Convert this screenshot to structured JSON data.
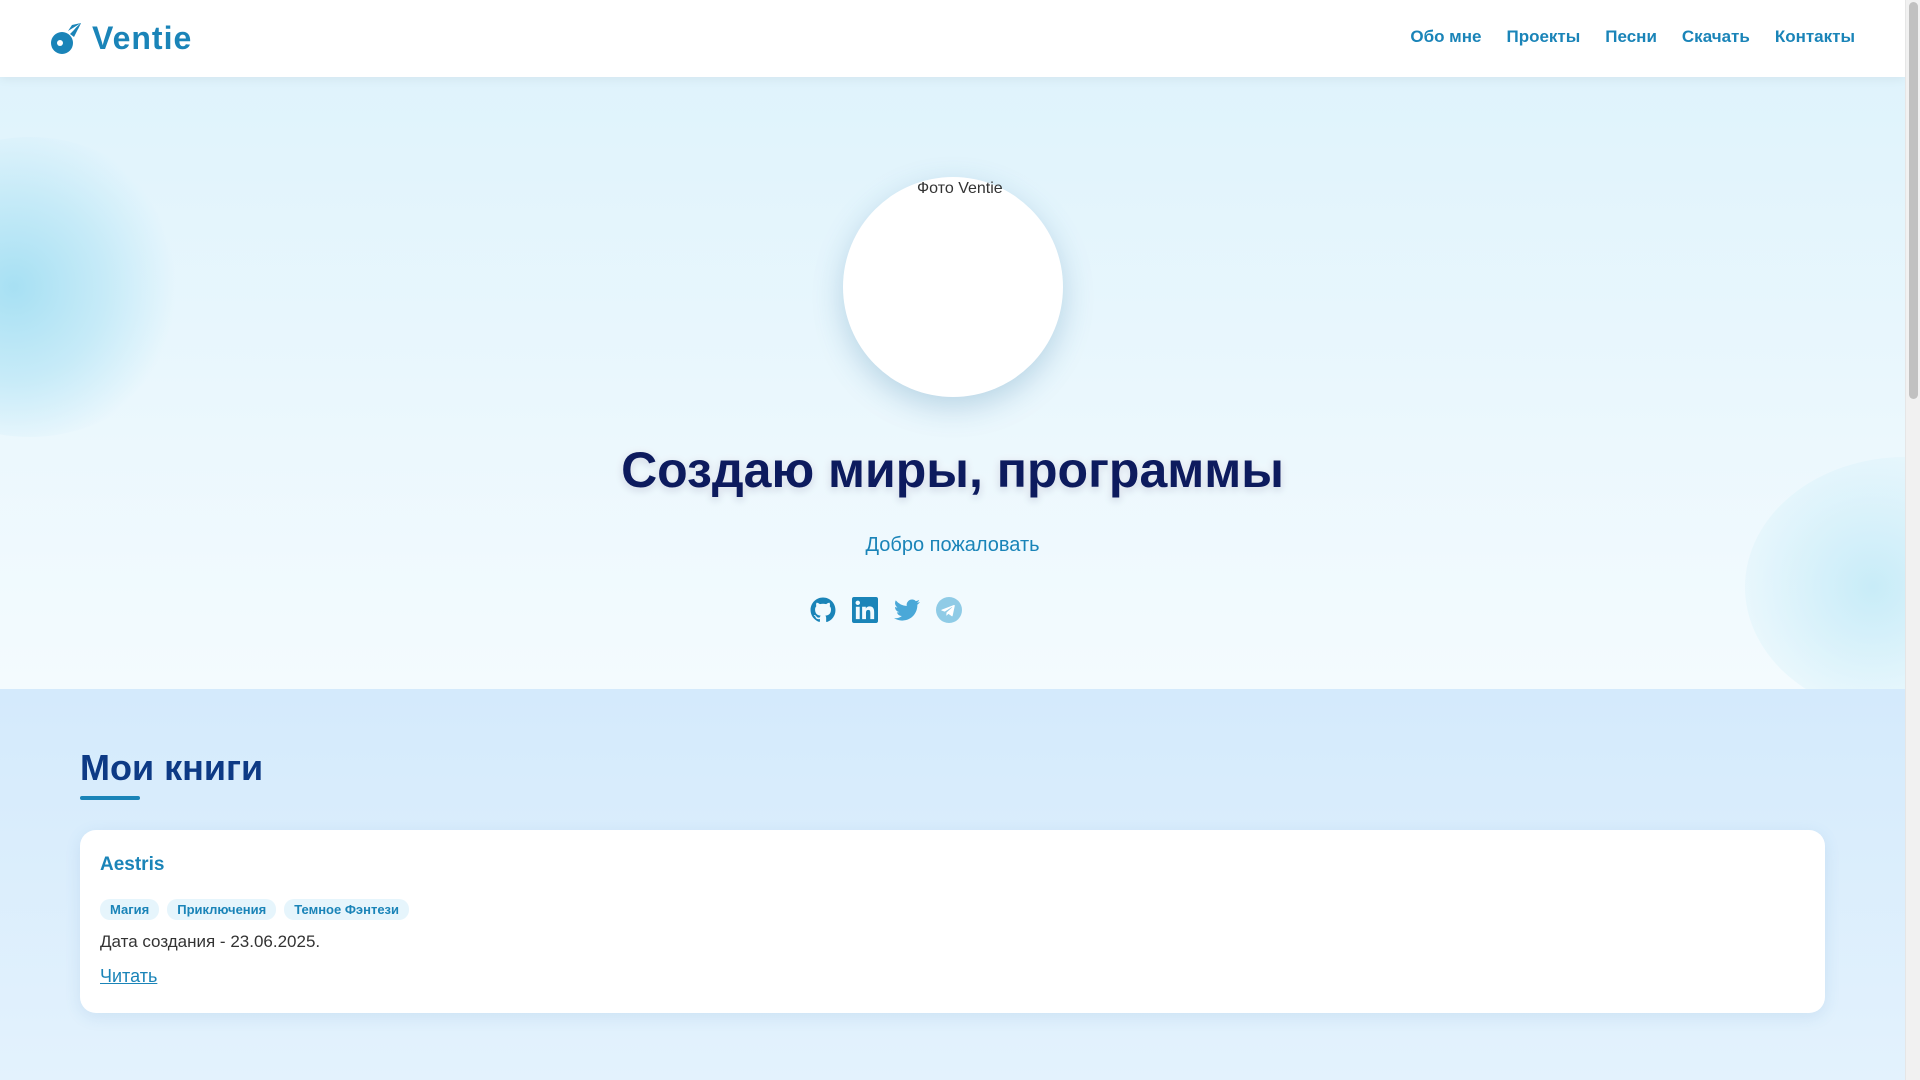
{
  "brand": {
    "name": "Ventie",
    "icon": "comet-icon",
    "color": "#1a84b8"
  },
  "nav": {
    "items": [
      {
        "label": "Обо мне"
      },
      {
        "label": "Проекты"
      },
      {
        "label": "Песни"
      },
      {
        "label": "Скачать"
      },
      {
        "label": "Контакты"
      }
    ]
  },
  "hero": {
    "avatar_alt": "Фото Ventie",
    "title": "Создаю миры, программы",
    "subtitle": "Добро пожаловать",
    "socials": [
      {
        "icon": "github-icon"
      },
      {
        "icon": "linkedin-icon"
      },
      {
        "icon": "twitter-icon"
      },
      {
        "icon": "telegram-icon"
      }
    ]
  },
  "books": {
    "title": "Мои книги",
    "items": [
      {
        "title": "Aestris",
        "tags": [
          "Магия",
          "Приключения",
          "Темное Фэнтези"
        ],
        "date": "Дата создания - 23.06.2025.",
        "link_label": "Читать"
      }
    ]
  }
}
